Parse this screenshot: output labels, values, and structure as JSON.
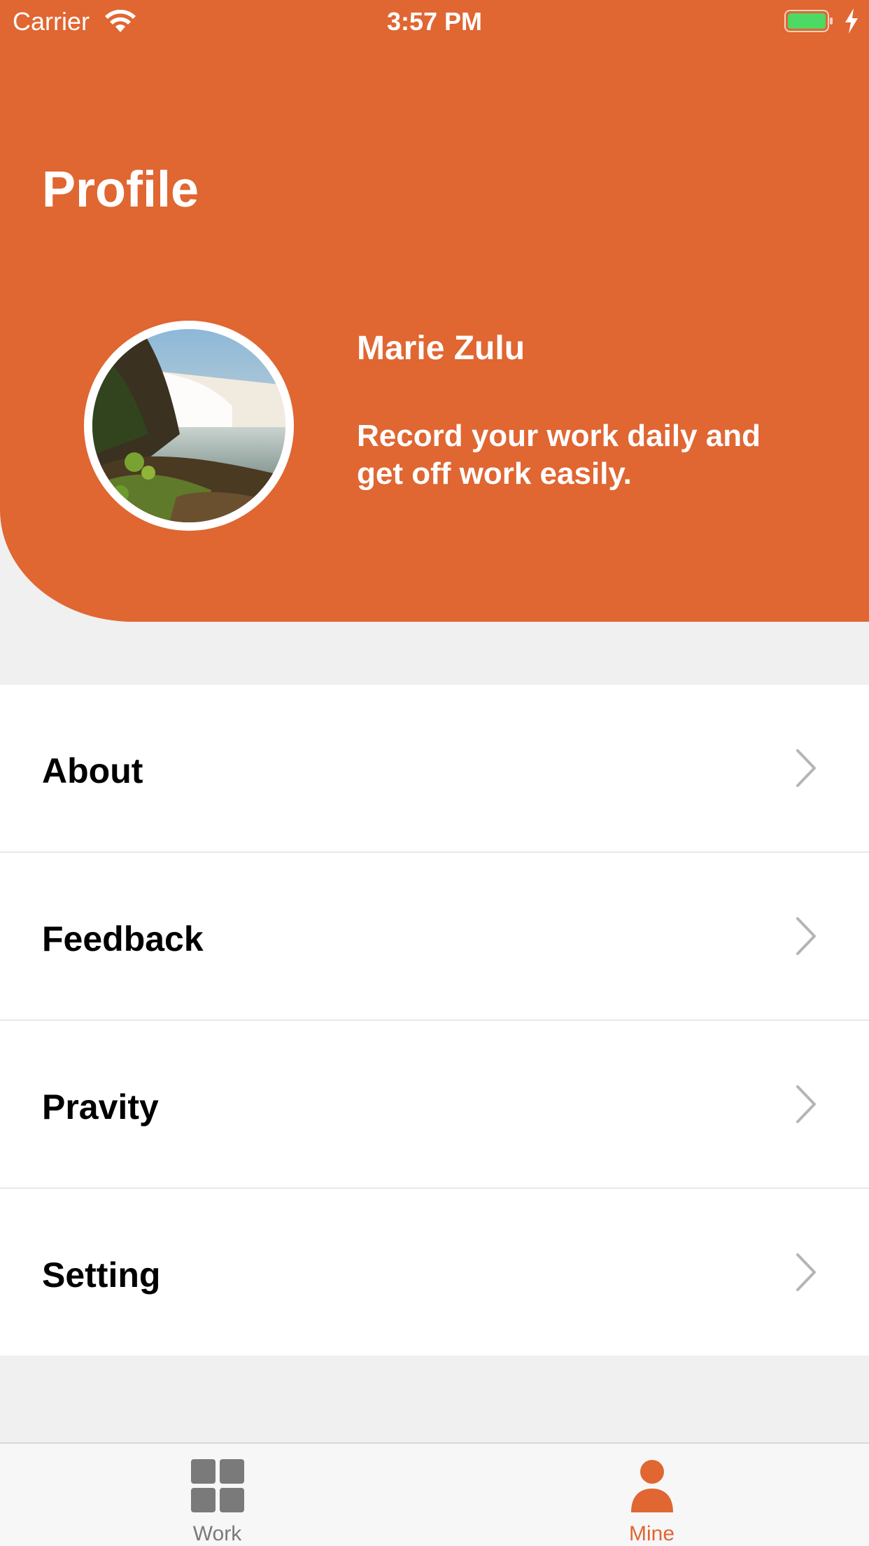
{
  "status_bar": {
    "carrier": "Carrier",
    "time": "3:57 PM",
    "battery_color": "#4cd964"
  },
  "header": {
    "title": "Profile",
    "background_color": "#e06632"
  },
  "profile": {
    "name": "Marie Zulu",
    "motto": "Record your work daily and get off work easily.",
    "avatar_icon": "waterfall-photo"
  },
  "menu": {
    "items": [
      {
        "label": "About",
        "icon": "chevron-right-icon"
      },
      {
        "label": "Feedback",
        "icon": "chevron-right-icon"
      },
      {
        "label": "Pravity",
        "icon": "chevron-right-icon"
      },
      {
        "label": "Setting",
        "icon": "chevron-right-icon"
      }
    ]
  },
  "tab_bar": {
    "tabs": [
      {
        "label": "Work",
        "icon": "grid-icon",
        "selected": false
      },
      {
        "label": "Mine",
        "icon": "person-icon",
        "selected": true
      }
    ],
    "active_color": "#e06632",
    "inactive_color": "#7a7a7a"
  }
}
